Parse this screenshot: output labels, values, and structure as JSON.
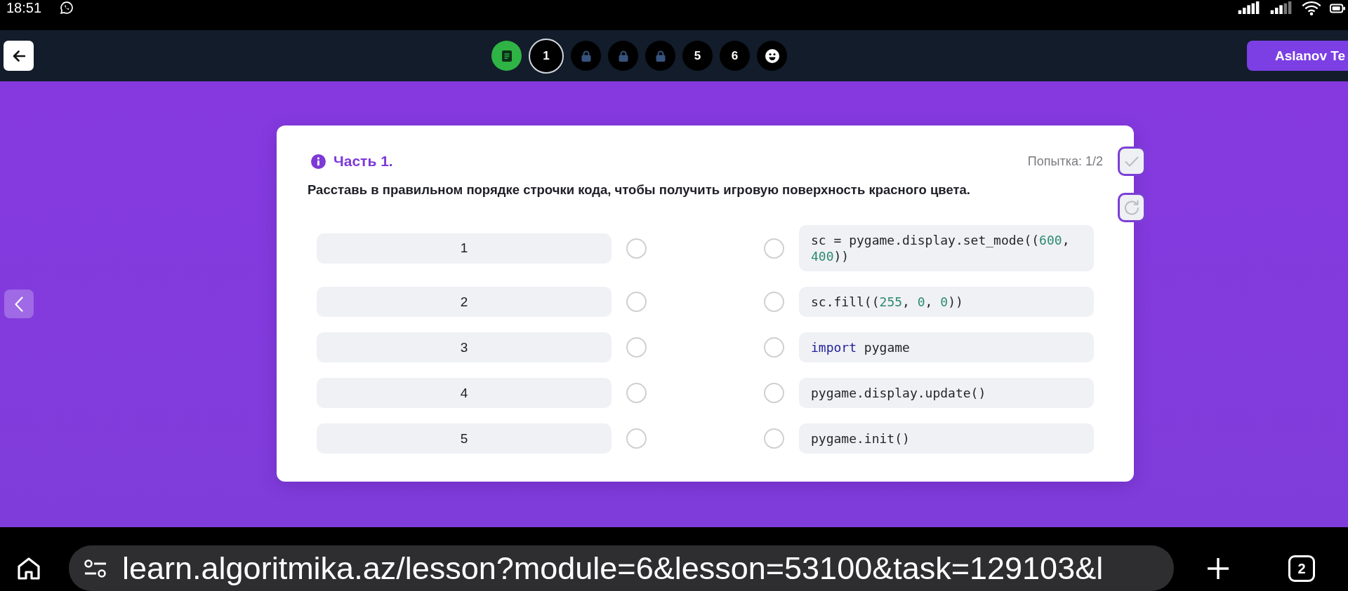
{
  "status_bar": {
    "time": "18:51"
  },
  "nav": {
    "steps": [
      {
        "kind": "page",
        "selected": false
      },
      {
        "kind": "number",
        "label": "1",
        "selected": true
      },
      {
        "kind": "locked",
        "selected": false
      },
      {
        "kind": "locked",
        "selected": false
      },
      {
        "kind": "locked",
        "selected": false
      },
      {
        "kind": "number",
        "label": "5",
        "selected": false
      },
      {
        "kind": "number",
        "label": "6",
        "selected": false
      },
      {
        "kind": "final",
        "selected": false
      }
    ],
    "user_button": "Aslanov Te"
  },
  "task": {
    "title": "Часть 1.",
    "attempt": "Попытка: 1/2",
    "instruction": "Расставь в правильном порядке строчки кода, чтобы получить игровую поверхность красного цвета.",
    "slots": [
      "1",
      "2",
      "3",
      "4",
      "5"
    ],
    "code_lines": [
      {
        "tokens": [
          {
            "kind": "plain",
            "text": "sc = pygame.display.set_mode(("
          },
          {
            "kind": "number",
            "text": "600"
          },
          {
            "kind": "plain",
            "text": ", "
          },
          {
            "kind": "number",
            "text": "400"
          },
          {
            "kind": "plain",
            "text": "))"
          }
        ]
      },
      {
        "tokens": [
          {
            "kind": "plain",
            "text": "sc.fill(("
          },
          {
            "kind": "number",
            "text": "255"
          },
          {
            "kind": "plain",
            "text": ", "
          },
          {
            "kind": "number",
            "text": "0"
          },
          {
            "kind": "plain",
            "text": ", "
          },
          {
            "kind": "number",
            "text": "0"
          },
          {
            "kind": "plain",
            "text": "))"
          }
        ]
      },
      {
        "tokens": [
          {
            "kind": "keyword",
            "text": "import"
          },
          {
            "kind": "plain",
            "text": " pygame"
          }
        ]
      },
      {
        "tokens": [
          {
            "kind": "plain",
            "text": "pygame.display.update()"
          }
        ]
      },
      {
        "tokens": [
          {
            "kind": "plain",
            "text": "pygame.init()"
          }
        ]
      }
    ]
  },
  "browser": {
    "url": "learn.algoritmika.az/lesson?module=6&lesson=53100&task=129103&l",
    "tab_count": "2"
  }
}
